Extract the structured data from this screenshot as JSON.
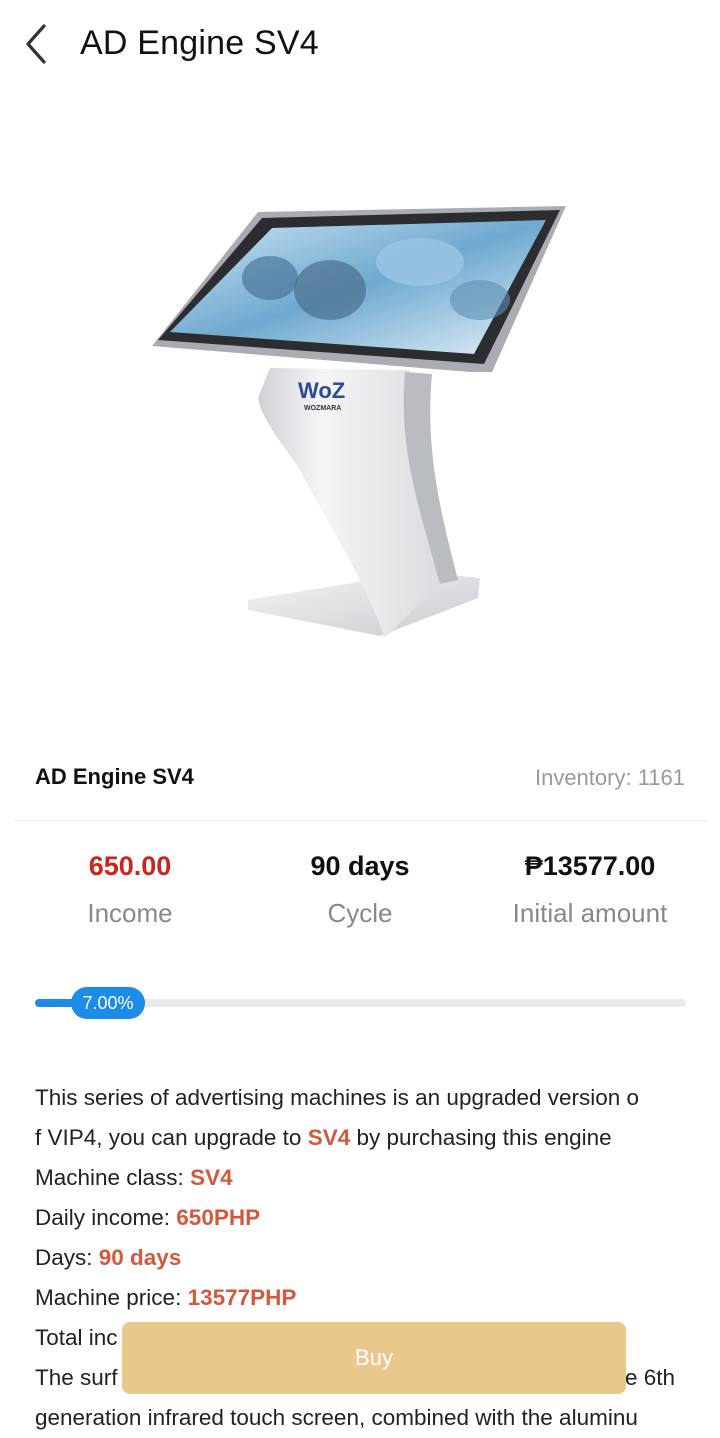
{
  "header": {
    "title": "AD Engine SV4",
    "back_icon": "chevron-left-icon"
  },
  "product": {
    "name": "AD Engine SV4",
    "inventory_label": "Inventory: ",
    "inventory_value": "1161",
    "image": {
      "brand_logo": "WoZ",
      "brand_sub": "WOZMARA"
    }
  },
  "stats": [
    {
      "value": "650.00",
      "label": "Income"
    },
    {
      "value": "90 days",
      "label": "Cycle"
    },
    {
      "value": "₱13577.00",
      "label": "Initial amount"
    }
  ],
  "progress": {
    "percent": 7.0,
    "label": "7.00%"
  },
  "description": {
    "intro_a": "This series of advertising machines is an upgraded version o",
    "intro_b": "f VIP4, you can upgrade to ",
    "intro_hl": "SV4",
    "intro_c": " by purchasing this engine",
    "machine_class_label": "Machine class: ",
    "machine_class_value": "SV4",
    "daily_income_label": "Daily income: ",
    "daily_income_value": "650PHP",
    "days_label": "Days: ",
    "days_value": "90 days",
    "price_label": "Machine price: ",
    "price_value": "13577PHP",
    "total_fragment": "Total inc",
    "surf_fragment": "The surf",
    "surf_tail": "e 6th",
    "last_line": "generation infrared touch screen, combined with the aluminu"
  },
  "buy_button": {
    "label": "Buy"
  },
  "colors": {
    "accent_blue": "#1c8ce8",
    "income_red": "#c8261f",
    "highlight": "#d4583c",
    "buy_gold": "#e9c88d"
  }
}
